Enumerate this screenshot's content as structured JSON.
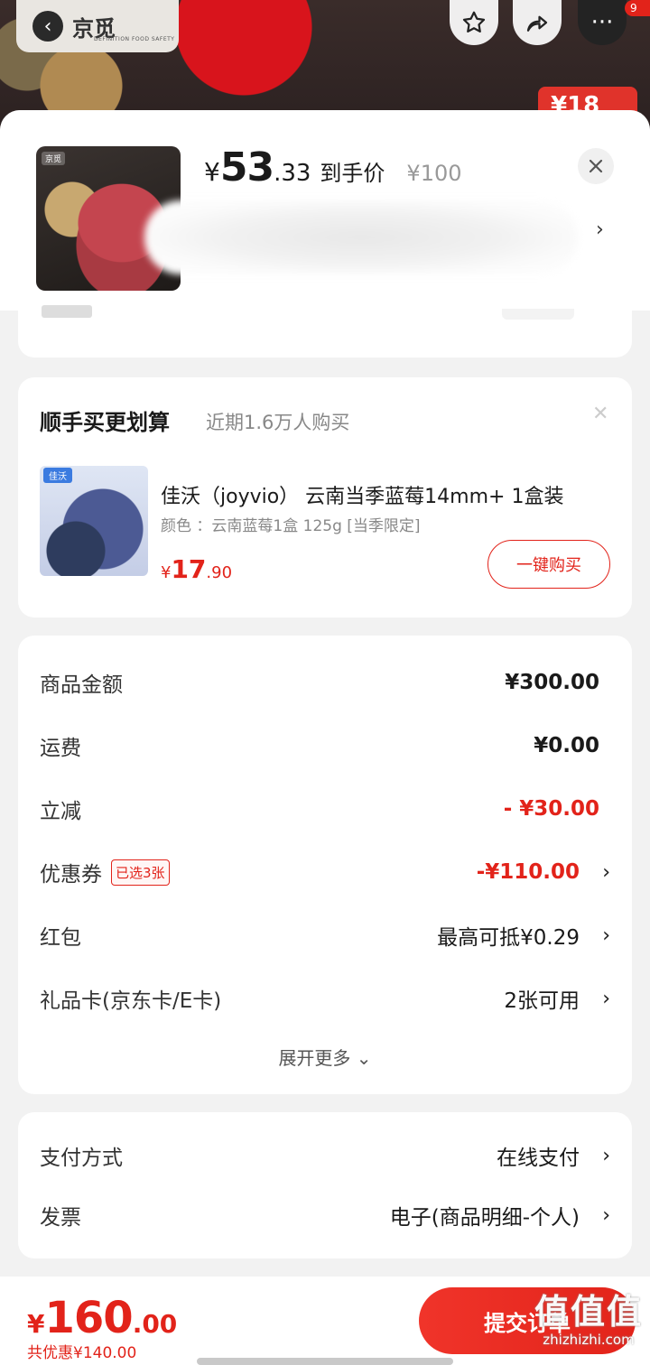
{
  "background": {
    "brand_logo_text": "京觅",
    "brand_logo_sub": "DEFINITION FOOD SAFETY",
    "badge": "9",
    "price_tag_partial": "¥18"
  },
  "product_header": {
    "price_yen": "¥",
    "price_int": "53",
    "price_dec": ".33",
    "price_tag": "到手价",
    "original_price": "¥100",
    "thumb_logo": "京觅"
  },
  "recommend": {
    "title": "顺手买更划算",
    "subtitle": "近期1.6万人购买",
    "item": {
      "image_tag": "佳沃",
      "name": "佳沃（joyvio） 云南当季蓝莓14mm+ 1盒装",
      "spec": "颜色 ：云南蓝莓1盒  125g  [当季限定]",
      "price_yen": "¥",
      "price_int": "17",
      "price_dec": ".90",
      "button": "一键购买"
    }
  },
  "amounts": {
    "goods_label": "商品金额",
    "goods_value": "¥300.00",
    "shipping_label": "运费",
    "shipping_value": "¥0.00",
    "discount_label": "立减",
    "discount_value": "- ¥30.00",
    "coupon_label": "优惠券",
    "coupon_chip": "已选3张",
    "coupon_value": "-¥110.00",
    "redpacket_label": "红包",
    "redpacket_value": "最高可抵¥0.29",
    "giftcard_label": "礼品卡(京东卡/E卡)",
    "giftcard_value": "2张可用",
    "expand_label": "展开更多 ⌄"
  },
  "payment": {
    "method_label": "支付方式",
    "method_value": "在线支付",
    "invoice_label": "发票",
    "invoice_value": "电子(商品明细-个人)"
  },
  "footer": {
    "total_yen": "¥",
    "total_int": "160",
    "total_dec": ".00",
    "saved": "共优惠¥140.00",
    "submit": "提交订单"
  },
  "watermark": {
    "big": "值值值",
    "small": "zhizhizhi.com"
  },
  "colors": {
    "accent": "#e2231a",
    "sheet_bg": "#f2f2f2"
  }
}
